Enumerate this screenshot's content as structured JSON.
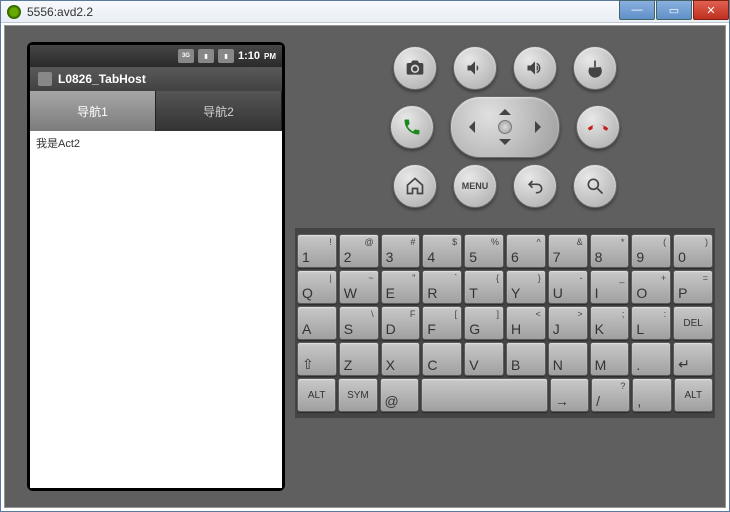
{
  "window": {
    "title": "5556:avd2.2"
  },
  "statusbar": {
    "time": "1:10",
    "ampm": "PM",
    "icon3g": "3G"
  },
  "app": {
    "title": "L0826_TabHost"
  },
  "tabs": [
    {
      "label": "导航1",
      "active": true
    },
    {
      "label": "导航2",
      "active": false
    }
  ],
  "content": {
    "text": "我是Act2"
  },
  "controls": {
    "menu": "MENU"
  },
  "keyboard": {
    "r1": [
      {
        "m": "1",
        "s": "!"
      },
      {
        "m": "2",
        "s": "@"
      },
      {
        "m": "3",
        "s": "#"
      },
      {
        "m": "4",
        "s": "$"
      },
      {
        "m": "5",
        "s": "%"
      },
      {
        "m": "6",
        "s": "^"
      },
      {
        "m": "7",
        "s": "&"
      },
      {
        "m": "8",
        "s": "*"
      },
      {
        "m": "9",
        "s": "("
      },
      {
        "m": "0",
        "s": ")"
      }
    ],
    "r2": [
      {
        "m": "Q",
        "s": "|"
      },
      {
        "m": "W",
        "s": "~"
      },
      {
        "m": "E",
        "s": "\""
      },
      {
        "m": "R",
        "s": "`"
      },
      {
        "m": "T",
        "s": "{"
      },
      {
        "m": "Y",
        "s": "}"
      },
      {
        "m": "U",
        "s": "-"
      },
      {
        "m": "I",
        "s": "_"
      },
      {
        "m": "O",
        "s": "+"
      },
      {
        "m": "P",
        "s": "="
      }
    ],
    "r3": [
      {
        "m": "A",
        "s": ""
      },
      {
        "m": "S",
        "s": "\\"
      },
      {
        "m": "D",
        "s": "F"
      },
      {
        "m": "F",
        "s": "["
      },
      {
        "m": "G",
        "s": "]"
      },
      {
        "m": "H",
        "s": "<"
      },
      {
        "m": "J",
        "s": ">"
      },
      {
        "m": "K",
        "s": ";"
      },
      {
        "m": "L",
        "s": ":"
      }
    ],
    "del": "DEL",
    "r4": [
      {
        "m": "Z",
        "s": ""
      },
      {
        "m": "X",
        "s": ""
      },
      {
        "m": "C",
        "s": ""
      },
      {
        "m": "V",
        "s": ""
      },
      {
        "m": "B",
        "s": ""
      },
      {
        "m": "N",
        "s": ""
      },
      {
        "m": "M",
        "s": ""
      },
      {
        "m": ".",
        "s": ""
      }
    ],
    "shift": "⇧",
    "enter": "↵",
    "alt": "ALT",
    "sym": "SYM",
    "at": "@",
    "space": "⎵",
    "slash": {
      "m": "/",
      "s": "?"
    },
    "comma": {
      "m": ",",
      "s": ""
    }
  }
}
